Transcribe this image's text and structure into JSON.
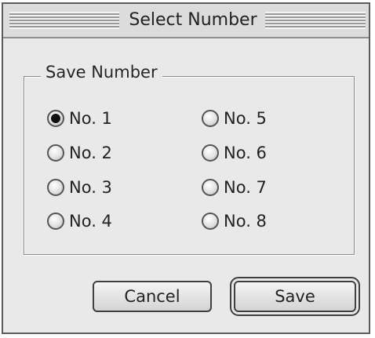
{
  "dialog": {
    "title": "Select Number"
  },
  "group": {
    "legend": "Save Number",
    "selected": "No. 1",
    "options": [
      {
        "label": "No. 1",
        "checked": true
      },
      {
        "label": "No. 2",
        "checked": false
      },
      {
        "label": "No. 3",
        "checked": false
      },
      {
        "label": "No. 4",
        "checked": false
      },
      {
        "label": "No. 5",
        "checked": false
      },
      {
        "label": "No. 6",
        "checked": false
      },
      {
        "label": "No. 7",
        "checked": false
      },
      {
        "label": "No. 8",
        "checked": false
      }
    ]
  },
  "buttons": {
    "cancel_label": "Cancel",
    "save_label": "Save"
  }
}
